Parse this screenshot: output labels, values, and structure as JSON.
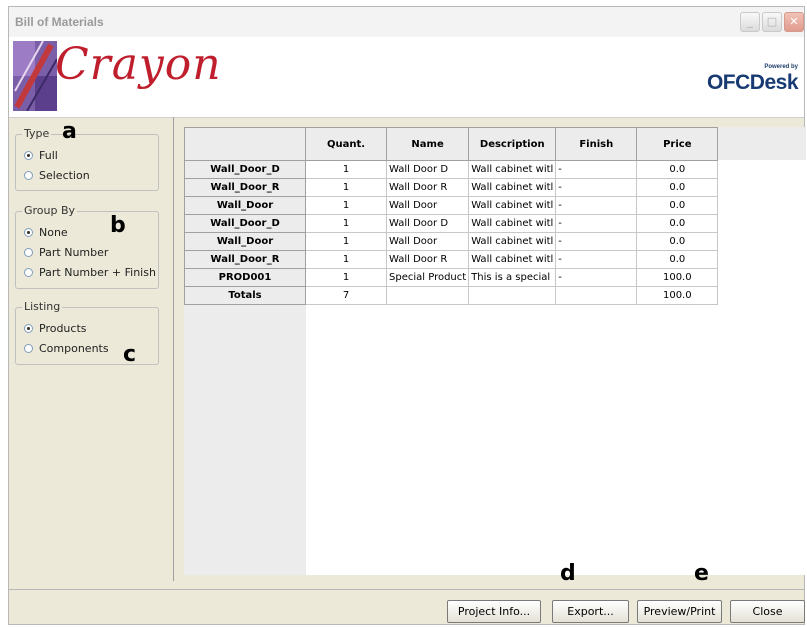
{
  "window": {
    "title": "Bill of Materials",
    "minimize_glyph": "_",
    "maximize_glyph": "□",
    "close_glyph": "✕"
  },
  "banner": {
    "crayon_logo_text": "Crayon",
    "powered_by": "Powered by",
    "ofcdesk_logo_text": "OFCDesk",
    "crayon_color": "#bf1e2d",
    "ofcdesk_color": "#173a72"
  },
  "type_group": {
    "legend": "Type",
    "options": [
      {
        "label": "Full",
        "selected": true
      },
      {
        "label": "Selection",
        "selected": false
      }
    ]
  },
  "groupby_group": {
    "legend": "Group By",
    "options": [
      {
        "label": "None",
        "selected": true
      },
      {
        "label": "Part Number",
        "selected": false
      },
      {
        "label": "Part Number + Finish",
        "selected": false
      }
    ]
  },
  "listing_group": {
    "legend": "Listing",
    "options": [
      {
        "label": "Products",
        "selected": true
      },
      {
        "label": "Components",
        "selected": false
      }
    ]
  },
  "callouts": {
    "a": "a",
    "b": "b",
    "c": "c",
    "d": "d",
    "e": "e"
  },
  "table": {
    "columns": [
      "Quant.",
      "Name",
      "Description",
      "Finish",
      "Price"
    ],
    "rows": [
      {
        "head": "Wall_Door_D",
        "qty": "1",
        "name": "Wall Door D",
        "desc": "Wall cabinet witl",
        "finish": "-",
        "price": "0.0"
      },
      {
        "head": "Wall_Door_R",
        "qty": "1",
        "name": "Wall Door R",
        "desc": "Wall cabinet witl",
        "finish": "-",
        "price": "0.0"
      },
      {
        "head": "Wall_Door",
        "qty": "1",
        "name": "Wall Door",
        "desc": "Wall cabinet witl",
        "finish": "-",
        "price": "0.0"
      },
      {
        "head": "Wall_Door_D",
        "qty": "1",
        "name": "Wall Door D",
        "desc": "Wall cabinet witl",
        "finish": "-",
        "price": "0.0"
      },
      {
        "head": "Wall_Door",
        "qty": "1",
        "name": "Wall Door",
        "desc": "Wall cabinet witl",
        "finish": "-",
        "price": "0.0"
      },
      {
        "head": "Wall_Door_R",
        "qty": "1",
        "name": "Wall Door R",
        "desc": "Wall cabinet witl",
        "finish": "-",
        "price": "0.0"
      },
      {
        "head": "PROD001",
        "qty": "1",
        "name": "Special Product",
        "desc": "This is a special",
        "finish": "-",
        "price": "100.0"
      }
    ],
    "totals": {
      "head": "Totals",
      "qty": "7",
      "name": "",
      "desc": "",
      "finish": "",
      "price": "100.0"
    }
  },
  "buttons": {
    "project_info": "Project Info...",
    "export": "Export...",
    "preview_print": "Preview/Print",
    "close": "Close"
  }
}
